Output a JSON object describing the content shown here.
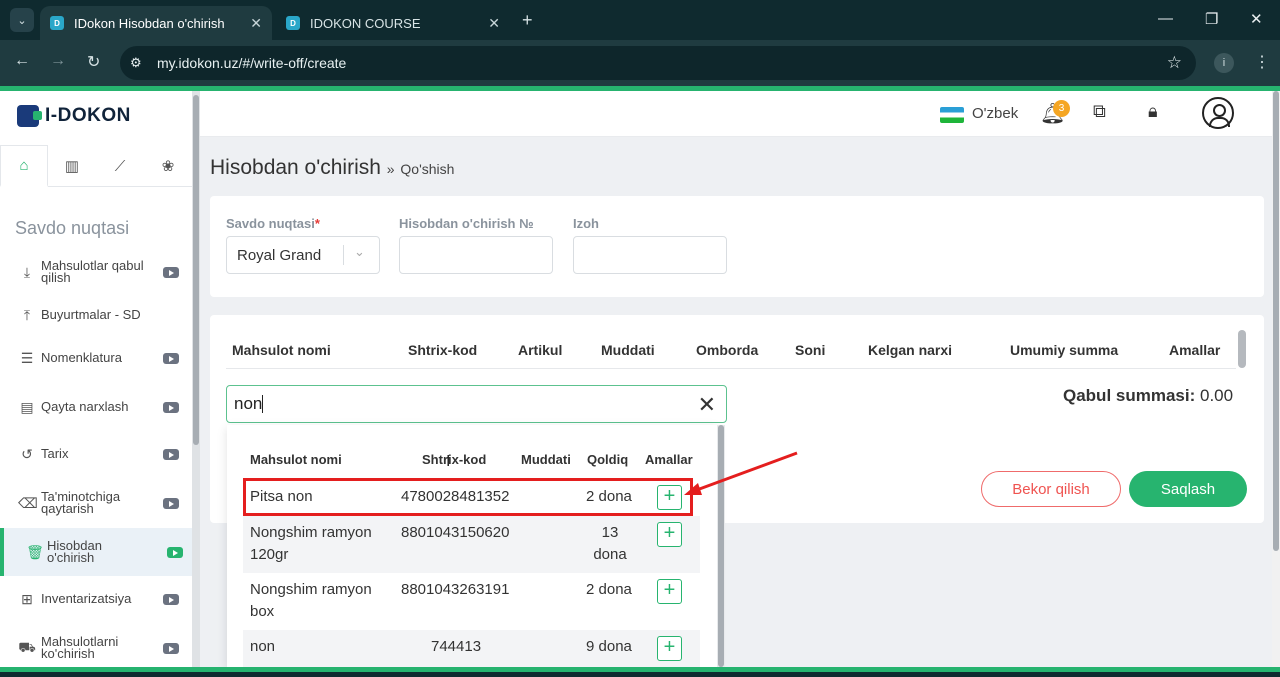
{
  "browser": {
    "tabs": [
      {
        "title": "IDokon Hisobdan o'chirish",
        "active": true
      },
      {
        "title": "IDOKON COURSE",
        "active": false
      }
    ],
    "url": "my.idokon.uz/#/write-off/create"
  },
  "sidebar": {
    "logo": "I-DOKON",
    "section_title": "Savdo nuqtasi",
    "items": [
      {
        "label": "Mahsulotlar qabul qilish",
        "icon": "inbox-download-icon"
      },
      {
        "label": "Buyurtmalar - SD",
        "icon": "upload-box-icon"
      },
      {
        "label": "Nomenklatura",
        "icon": "list-icon"
      },
      {
        "label": "Qayta narxlash",
        "icon": "price-tag-icon"
      },
      {
        "label": "Tarix",
        "icon": "history-icon"
      },
      {
        "label": "Ta'minotchiga qaytarish",
        "icon": "return-icon"
      },
      {
        "label": "Hisobdan o'chirish",
        "icon": "trash-icon",
        "active": true
      },
      {
        "label": "Inventarizatsiya",
        "icon": "grid-icon"
      },
      {
        "label": "Mahsulotlarni ko'chirish",
        "icon": "truck-icon"
      }
    ]
  },
  "header": {
    "language": "O'zbek",
    "notification_count": "3"
  },
  "page": {
    "title": "Hisobdan o'chirish",
    "breadcrumb_sep": "»",
    "subtitle": "Qo'shish"
  },
  "form": {
    "store_label": "Savdo nuqtasi",
    "store_required": "*",
    "store_value": "Royal Grand",
    "number_label": "Hisobdan o'chirish №",
    "number_value": "",
    "note_label": "Izoh",
    "note_value": ""
  },
  "table": {
    "headers": [
      "Mahsulot nomi",
      "Shtrix-kod",
      "Artikul",
      "Muddati",
      "Omborda",
      "Soni",
      "Kelgan narxi",
      "Umumiy summa",
      "Amallar"
    ]
  },
  "summary": {
    "label": "Qabul summasi:",
    "value": "0.00"
  },
  "buttons": {
    "cancel": "Bekor qilish",
    "save": "Saqlash"
  },
  "search": {
    "value": "non"
  },
  "dropdown": {
    "headers": [
      "Mahsulot nomi",
      "Shtrix-kod",
      "Muddati",
      "Qoldiq",
      "Amallar"
    ],
    "rows": [
      {
        "name": "Pitsa non",
        "barcode": "4780028481352",
        "expiry": "",
        "stock": "2 dona"
      },
      {
        "name": "Nongshim ramyon 120gr",
        "barcode": "8801043150620",
        "expiry": "",
        "stock": "13 dona"
      },
      {
        "name": "Nongshim ramyon box",
        "barcode": "8801043263191",
        "expiry": "",
        "stock": "2 dona"
      },
      {
        "name": "non",
        "barcode": "744413",
        "expiry": "",
        "stock": "9 dona"
      }
    ],
    "add_symbol": "+"
  },
  "colors": {
    "accent": "#27b46f",
    "danger": "#e41e1e",
    "browser_dark": "#0f2a2f"
  }
}
